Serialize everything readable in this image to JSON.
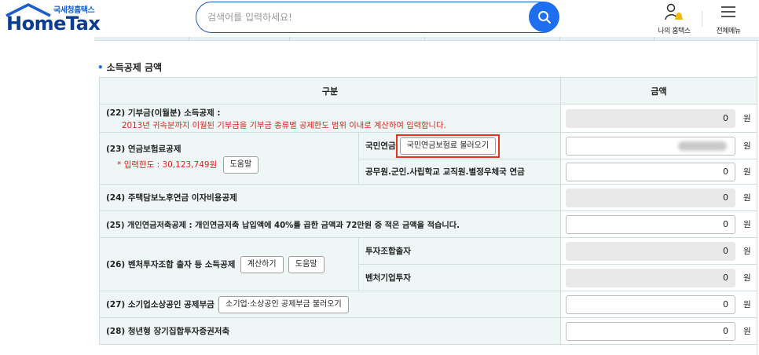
{
  "header": {
    "logo_sub": "국세청홈택스",
    "logo_main": "HomeTax",
    "search_placeholder": "검색어를 입력하세요!",
    "my_hometax_label": "나의 홈택스",
    "all_menu_label": "전체메뉴",
    "colors": {
      "brand": "#0a3d8f",
      "search_button": "#1e6ff0",
      "alert_bell": "#f5b800"
    }
  },
  "section": {
    "title": "소득공제 금액"
  },
  "table": {
    "headers": {
      "category": "구분",
      "amount": "금액"
    },
    "currency_unit": "원",
    "rows": {
      "r22": {
        "label": "(22) 기부금(이월분) 소득공제 :",
        "note": "2013년 귀속분까지 이월된 기부금을 기부금 종류별 공제한도 범위 이내로 계산하여 입력합니다.",
        "value": "0"
      },
      "r23": {
        "label": "(23) 연금보험료공제",
        "limit": "* 입력한도 : 30,123,749원",
        "help_button": "도움말",
        "sub1": {
          "label": "국민연금",
          "button": "국민연금보험료 불러오기",
          "value": ""
        },
        "sub2": {
          "label": "공무원.군인.사립학교 교직원.별정우체국 연금",
          "value": "0"
        }
      },
      "r24": {
        "label": "(24) 주택담보노후연금 이자비용공제",
        "value": "0"
      },
      "r25": {
        "label": "(25) 개인연금저축공제 : 개인연금저축 납입액에 40%를 곱한 금액과 72만원 중 적은 금액을 적습니다.",
        "value": "0"
      },
      "r26": {
        "label": "(26) 벤처투자조합 출자 등 소득공제",
        "calc_button": "계산하기",
        "help_button": "도움말",
        "sub1": {
          "label": "투자조합출자",
          "value": "0"
        },
        "sub2": {
          "label": "벤처기업투자",
          "value": "0"
        }
      },
      "r27": {
        "label": "(27) 소기업소상공인 공제부금",
        "button": "소기업·소상공인 공제부금 불러오기",
        "value": "0"
      },
      "r28": {
        "label": "(28) 청년형 장기집합투자증권저축",
        "value": "0"
      }
    }
  }
}
